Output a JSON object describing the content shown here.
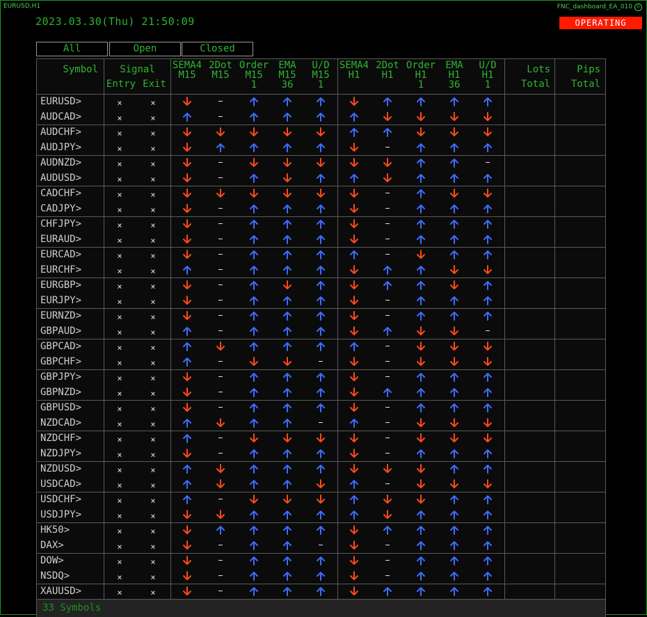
{
  "window": {
    "chart_label": "EURUSD,H1",
    "ea_name": "FNC_dashboard_EA_010",
    "smiley": "☺"
  },
  "header": {
    "datetime": "2023.03.30(Thu) 21:50:09",
    "status": "OPERATING"
  },
  "colors": {
    "up": "#3d6dff",
    "down": "#ff4a1a",
    "accent": "#2fb52f",
    "status_bg": "#ff1a00"
  },
  "filters": [
    "All",
    "Open",
    "Closed"
  ],
  "columns": {
    "symbol": "Symbol",
    "signal": "Signal",
    "entry": "Entry",
    "exit": "Exit",
    "m15": [
      [
        "SEMA4",
        "M15"
      ],
      [
        "2Dot",
        "M15"
      ],
      [
        "Order",
        "M15",
        "1"
      ],
      [
        "EMA",
        "M15",
        "36"
      ],
      [
        "U/D",
        "M15",
        "1"
      ]
    ],
    "h1": [
      [
        "SEMA4",
        "H1"
      ],
      [
        "2Dot",
        "H1"
      ],
      [
        "Order",
        "H1",
        "1"
      ],
      [
        "EMA",
        "H1",
        "36"
      ],
      [
        "U/D",
        "H1",
        "1"
      ]
    ],
    "lots": [
      "Lots",
      "Total"
    ],
    "pips": [
      "Pips",
      "Total"
    ]
  },
  "rows": [
    {
      "symbol": "EURUSD",
      "entry": "×",
      "exit": "×",
      "signals": [
        "d",
        "-",
        "u",
        "u",
        "u",
        "d",
        "u",
        "u",
        "u",
        "u"
      ]
    },
    {
      "symbol": "AUDCAD",
      "entry": "×",
      "exit": "×",
      "signals": [
        "u",
        "-",
        "u",
        "u",
        "u",
        "u",
        "d",
        "d",
        "d",
        "d"
      ]
    },
    {
      "symbol": "AUDCHF",
      "entry": "×",
      "exit": "×",
      "signals": [
        "d",
        "d",
        "d",
        "d",
        "d",
        "u",
        "u",
        "d",
        "d",
        "d"
      ]
    },
    {
      "symbol": "AUDJPY",
      "entry": "×",
      "exit": "×",
      "signals": [
        "d",
        "u",
        "u",
        "u",
        "u",
        "d",
        "-",
        "u",
        "u",
        "u"
      ]
    },
    {
      "symbol": "AUDNZD",
      "entry": "×",
      "exit": "×",
      "signals": [
        "d",
        "-",
        "d",
        "d",
        "d",
        "d",
        "d",
        "u",
        "u",
        "-"
      ]
    },
    {
      "symbol": "AUDUSD",
      "entry": "×",
      "exit": "×",
      "signals": [
        "d",
        "-",
        "u",
        "d",
        "u",
        "u",
        "d",
        "u",
        "u",
        "u"
      ]
    },
    {
      "symbol": "CADCHF",
      "entry": "×",
      "exit": "×",
      "signals": [
        "d",
        "d",
        "d",
        "d",
        "d",
        "d",
        "-",
        "u",
        "d",
        "d"
      ]
    },
    {
      "symbol": "CADJPY",
      "entry": "×",
      "exit": "×",
      "signals": [
        "d",
        "-",
        "u",
        "u",
        "u",
        "d",
        "-",
        "u",
        "u",
        "u"
      ]
    },
    {
      "symbol": "CHFJPY",
      "entry": "×",
      "exit": "×",
      "signals": [
        "d",
        "-",
        "u",
        "u",
        "u",
        "d",
        "-",
        "u",
        "u",
        "u"
      ]
    },
    {
      "symbol": "EURAUD",
      "entry": "×",
      "exit": "×",
      "signals": [
        "d",
        "-",
        "u",
        "u",
        "u",
        "d",
        "-",
        "u",
        "u",
        "u"
      ]
    },
    {
      "symbol": "EURCAD",
      "entry": "×",
      "exit": "×",
      "signals": [
        "d",
        "-",
        "u",
        "u",
        "u",
        "u",
        "-",
        "d",
        "u",
        "u"
      ]
    },
    {
      "symbol": "EURCHF",
      "entry": "×",
      "exit": "×",
      "signals": [
        "u",
        "-",
        "u",
        "u",
        "u",
        "d",
        "u",
        "u",
        "d",
        "d"
      ]
    },
    {
      "symbol": "EURGBP",
      "entry": "×",
      "exit": "×",
      "signals": [
        "d",
        "-",
        "u",
        "d",
        "u",
        "d",
        "u",
        "u",
        "d",
        "u"
      ]
    },
    {
      "symbol": "EURJPY",
      "entry": "×",
      "exit": "×",
      "signals": [
        "d",
        "-",
        "u",
        "u",
        "u",
        "d",
        "-",
        "u",
        "u",
        "u"
      ]
    },
    {
      "symbol": "EURNZD",
      "entry": "×",
      "exit": "×",
      "signals": [
        "d",
        "-",
        "u",
        "u",
        "u",
        "d",
        "-",
        "u",
        "u",
        "u"
      ]
    },
    {
      "symbol": "GBPAUD",
      "entry": "×",
      "exit": "×",
      "signals": [
        "u",
        "-",
        "u",
        "u",
        "u",
        "d",
        "u",
        "d",
        "d",
        "-"
      ]
    },
    {
      "symbol": "GBPCAD",
      "entry": "×",
      "exit": "×",
      "signals": [
        "u",
        "d",
        "u",
        "u",
        "u",
        "u",
        "-",
        "d",
        "d",
        "d"
      ]
    },
    {
      "symbol": "GBPCHF",
      "entry": "×",
      "exit": "×",
      "signals": [
        "u",
        "-",
        "d",
        "d",
        "-",
        "d",
        "-",
        "d",
        "d",
        "d"
      ]
    },
    {
      "symbol": "GBPJPY",
      "entry": "×",
      "exit": "×",
      "signals": [
        "d",
        "-",
        "u",
        "u",
        "u",
        "d",
        "-",
        "u",
        "u",
        "u"
      ]
    },
    {
      "symbol": "GBPNZD",
      "entry": "×",
      "exit": "×",
      "signals": [
        "d",
        "-",
        "u",
        "u",
        "u",
        "d",
        "u",
        "u",
        "u",
        "u"
      ]
    },
    {
      "symbol": "GBPUSD",
      "entry": "×",
      "exit": "×",
      "signals": [
        "d",
        "-",
        "u",
        "u",
        "u",
        "d",
        "-",
        "u",
        "u",
        "u"
      ]
    },
    {
      "symbol": "NZDCAD",
      "entry": "×",
      "exit": "×",
      "signals": [
        "u",
        "d",
        "u",
        "u",
        "-",
        "u",
        "-",
        "d",
        "d",
        "d"
      ]
    },
    {
      "symbol": "NZDCHF",
      "entry": "×",
      "exit": "×",
      "signals": [
        "u",
        "-",
        "d",
        "d",
        "d",
        "d",
        "-",
        "d",
        "d",
        "d"
      ]
    },
    {
      "symbol": "NZDJPY",
      "entry": "×",
      "exit": "×",
      "signals": [
        "d",
        "-",
        "u",
        "u",
        "u",
        "d",
        "-",
        "u",
        "u",
        "u"
      ]
    },
    {
      "symbol": "NZDUSD",
      "entry": "×",
      "exit": "×",
      "signals": [
        "u",
        "d",
        "u",
        "u",
        "u",
        "d",
        "d",
        "d",
        "u",
        "u"
      ]
    },
    {
      "symbol": "USDCAD",
      "entry": "×",
      "exit": "×",
      "signals": [
        "u",
        "d",
        "u",
        "u",
        "d",
        "u",
        "-",
        "d",
        "d",
        "d"
      ]
    },
    {
      "symbol": "USDCHF",
      "entry": "×",
      "exit": "×",
      "signals": [
        "u",
        "-",
        "d",
        "d",
        "d",
        "u",
        "d",
        "d",
        "u",
        "u"
      ]
    },
    {
      "symbol": "USDJPY",
      "entry": "×",
      "exit": "×",
      "signals": [
        "d",
        "d",
        "u",
        "u",
        "u",
        "u",
        "d",
        "u",
        "u",
        "u"
      ]
    },
    {
      "symbol": "HK50",
      "entry": "×",
      "exit": "×",
      "signals": [
        "d",
        "u",
        "u",
        "u",
        "u",
        "d",
        "u",
        "u",
        "u",
        "u"
      ]
    },
    {
      "symbol": "DAX",
      "entry": "×",
      "exit": "×",
      "signals": [
        "d",
        "-",
        "u",
        "u",
        "-",
        "d",
        "-",
        "u",
        "u",
        "u"
      ]
    },
    {
      "symbol": "DOW",
      "entry": "×",
      "exit": "×",
      "signals": [
        "d",
        "-",
        "u",
        "u",
        "u",
        "d",
        "-",
        "u",
        "u",
        "u"
      ]
    },
    {
      "symbol": "NSDQ",
      "entry": "×",
      "exit": "×",
      "signals": [
        "d",
        "-",
        "u",
        "u",
        "u",
        "d",
        "-",
        "u",
        "u",
        "u"
      ]
    },
    {
      "symbol": "XAUUSD",
      "entry": "×",
      "exit": "×",
      "signals": [
        "d",
        "-",
        "u",
        "u",
        "u",
        "d",
        "u",
        "u",
        "u",
        "u"
      ]
    }
  ],
  "footer": {
    "count_label": "33 Symbols"
  }
}
